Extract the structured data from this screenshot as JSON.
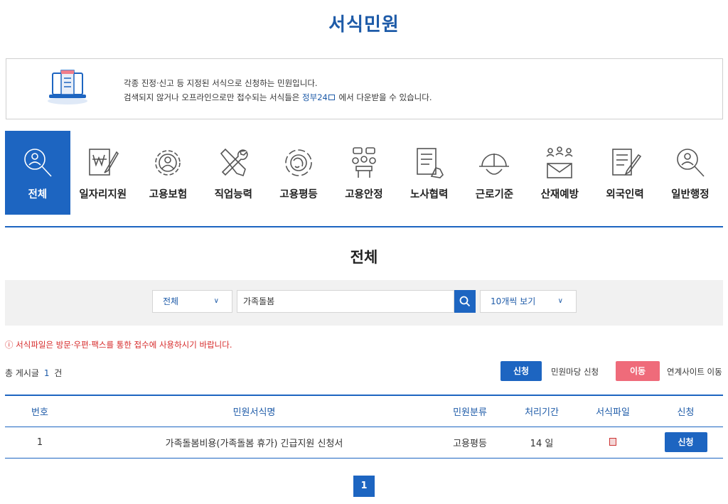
{
  "page": {
    "title": "서식민원"
  },
  "notice": {
    "line1": "각종 진정·신고 등 지정된 서식으로 신청하는 민원입니다.",
    "line2_prefix": "검색되지 않거나 오프라인으로만 접수되는 서식들은",
    "link": "정부24",
    "line2_suffix": "에서 다운받을 수 있습니다."
  },
  "categories": [
    {
      "label": "전체",
      "icon": "magnifier-person-icon"
    },
    {
      "label": "일자리지원",
      "icon": "won-pen-icon"
    },
    {
      "label": "고용보험",
      "icon": "gear-person-icon"
    },
    {
      "label": "직업능력",
      "icon": "tools-icon"
    },
    {
      "label": "고용평등",
      "icon": "globe-cycle-icon"
    },
    {
      "label": "고용안정",
      "icon": "meeting-people-icon"
    },
    {
      "label": "노사협력",
      "icon": "document-hand-icon"
    },
    {
      "label": "근로기준",
      "icon": "helmet-icon"
    },
    {
      "label": "산재예방",
      "icon": "people-mail-icon"
    },
    {
      "label": "외국인력",
      "icon": "document-pen-icon"
    },
    {
      "label": "일반행정",
      "icon": "magnifier-person-icon"
    }
  ],
  "section": {
    "title": "전체"
  },
  "search": {
    "category_value": "전체",
    "query": "가족돌봄",
    "page_size_value": "10개씩 보기"
  },
  "warning": "ⓘ 서식파일은 방문·우편·팩스를 통한 접수에 사용하시기 바랍니다.",
  "total": {
    "prefix": "총 게시글",
    "count": "1",
    "suffix": "건"
  },
  "legend": {
    "apply_button": "신청",
    "apply_label": "민원마당 신청",
    "move_button": "이동",
    "move_label": "연계사이트 이동"
  },
  "table": {
    "headers": [
      "번호",
      "민원서식명",
      "민원분류",
      "처리기간",
      "서식파일",
      "신청"
    ],
    "rows": [
      {
        "no": "1",
        "name": "가족돌봄비용(가족돌봄 휴가) 긴급지원 신청서",
        "category": "고용평등",
        "period": "14 일",
        "file": "hwp-file-icon",
        "action": "신청"
      }
    ]
  },
  "pagination": {
    "current": "1"
  },
  "colors": {
    "primary": "#1d65c1",
    "title": "#1e5ba8",
    "move": "#ef6b7a",
    "warning": "#d62a2a"
  }
}
